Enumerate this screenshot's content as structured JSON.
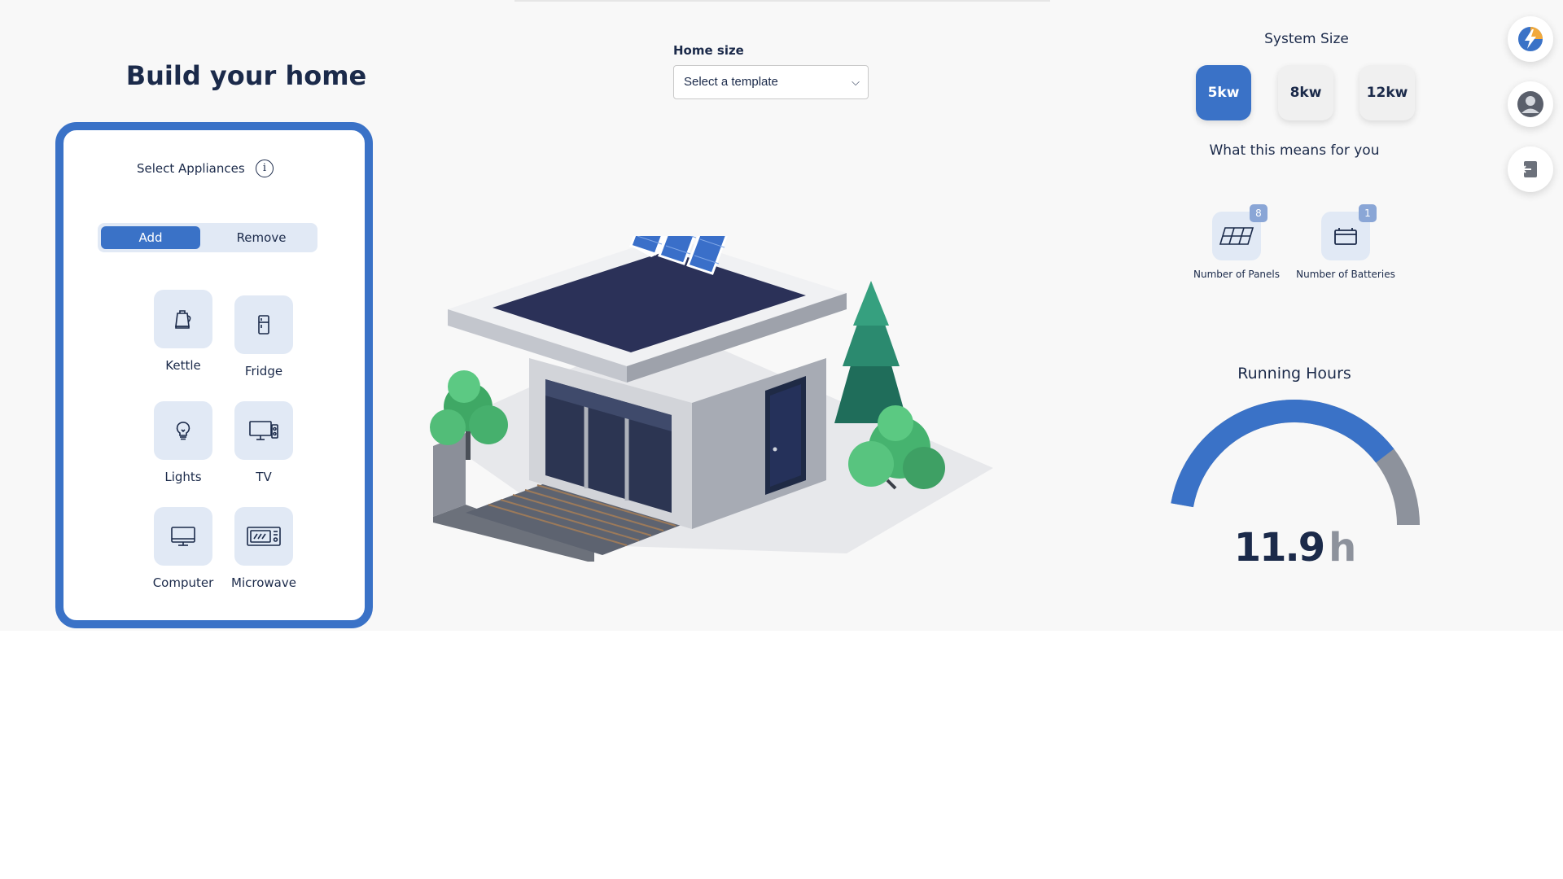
{
  "header": {
    "title": "Build your home"
  },
  "appliances_panel": {
    "select_label": "Select Appliances",
    "info_icon": "info-icon",
    "toggle": {
      "add_label": "Add",
      "remove_label": "Remove",
      "active": "Add"
    },
    "items": [
      {
        "label": "Kettle",
        "icon": "kettle-icon"
      },
      {
        "label": "Fridge",
        "icon": "fridge-icon"
      },
      {
        "label": "Lights",
        "icon": "lightbulb-icon"
      },
      {
        "label": "TV",
        "icon": "tv-icon"
      },
      {
        "label": "Computer",
        "icon": "computer-icon"
      },
      {
        "label": "Microwave",
        "icon": "microwave-icon"
      }
    ]
  },
  "home_size": {
    "label": "Home size",
    "selected": "Select a template"
  },
  "system_size": {
    "title": "System Size",
    "options": [
      "5kw",
      "8kw",
      "12kw"
    ],
    "selected": "5kw",
    "means_label": "What this means for you",
    "stats": [
      {
        "label": "Number of Panels",
        "count": "8",
        "icon": "solar-panel-icon"
      },
      {
        "label": "Number of Batteries",
        "count": "1",
        "icon": "battery-icon"
      }
    ]
  },
  "running_hours": {
    "title": "Running Hours",
    "value": "11.9",
    "unit": "h",
    "gauge_fill_fraction": 0.78
  },
  "side_actions": [
    {
      "icon": "app-logo-icon"
    },
    {
      "icon": "user-avatar-icon"
    },
    {
      "icon": "logout-icon"
    }
  ],
  "colors": {
    "accent": "#3a72c7",
    "text": "#1b2a4a",
    "tile": "#e1e9f5",
    "gauge_track": "#8d929c"
  }
}
